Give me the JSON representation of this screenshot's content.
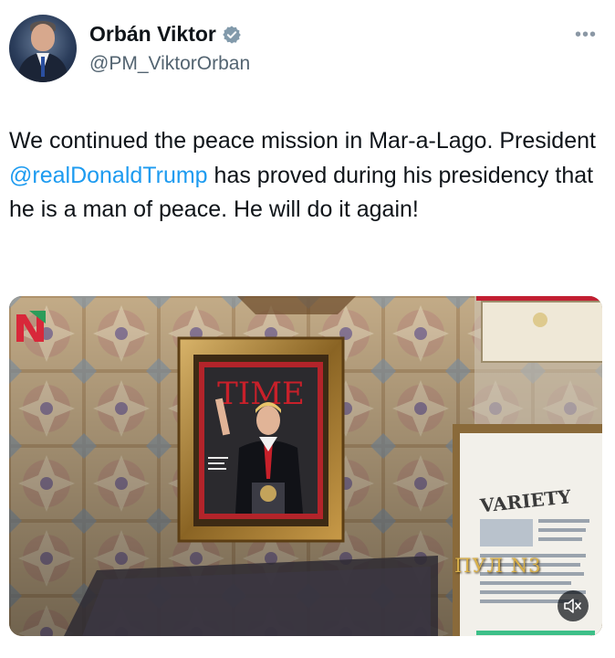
{
  "author": {
    "display_name": "Orbán Viktor",
    "handle": "@PM_ViktorOrban",
    "verified_icon": "verified-badge-icon"
  },
  "menu": {
    "more_label": "•••"
  },
  "tweet": {
    "text_before": "We continued the peace mission in Mar-a-Lago. President ",
    "mention": "@realDonaldTrump",
    "text_after": " has proved during his presidency that he is a man of peace. He will do it again!"
  },
  "media": {
    "magazine_title": "TIME",
    "poster_title": "VARIETY",
    "watermark": "ПУЛ N3",
    "mute_icon": "speaker-muted-icon"
  },
  "colors": {
    "mention": "#1d9bf0",
    "verified": "#829aab",
    "progress_top": "#c21f32",
    "progress_bottom": "#3dbf88"
  }
}
